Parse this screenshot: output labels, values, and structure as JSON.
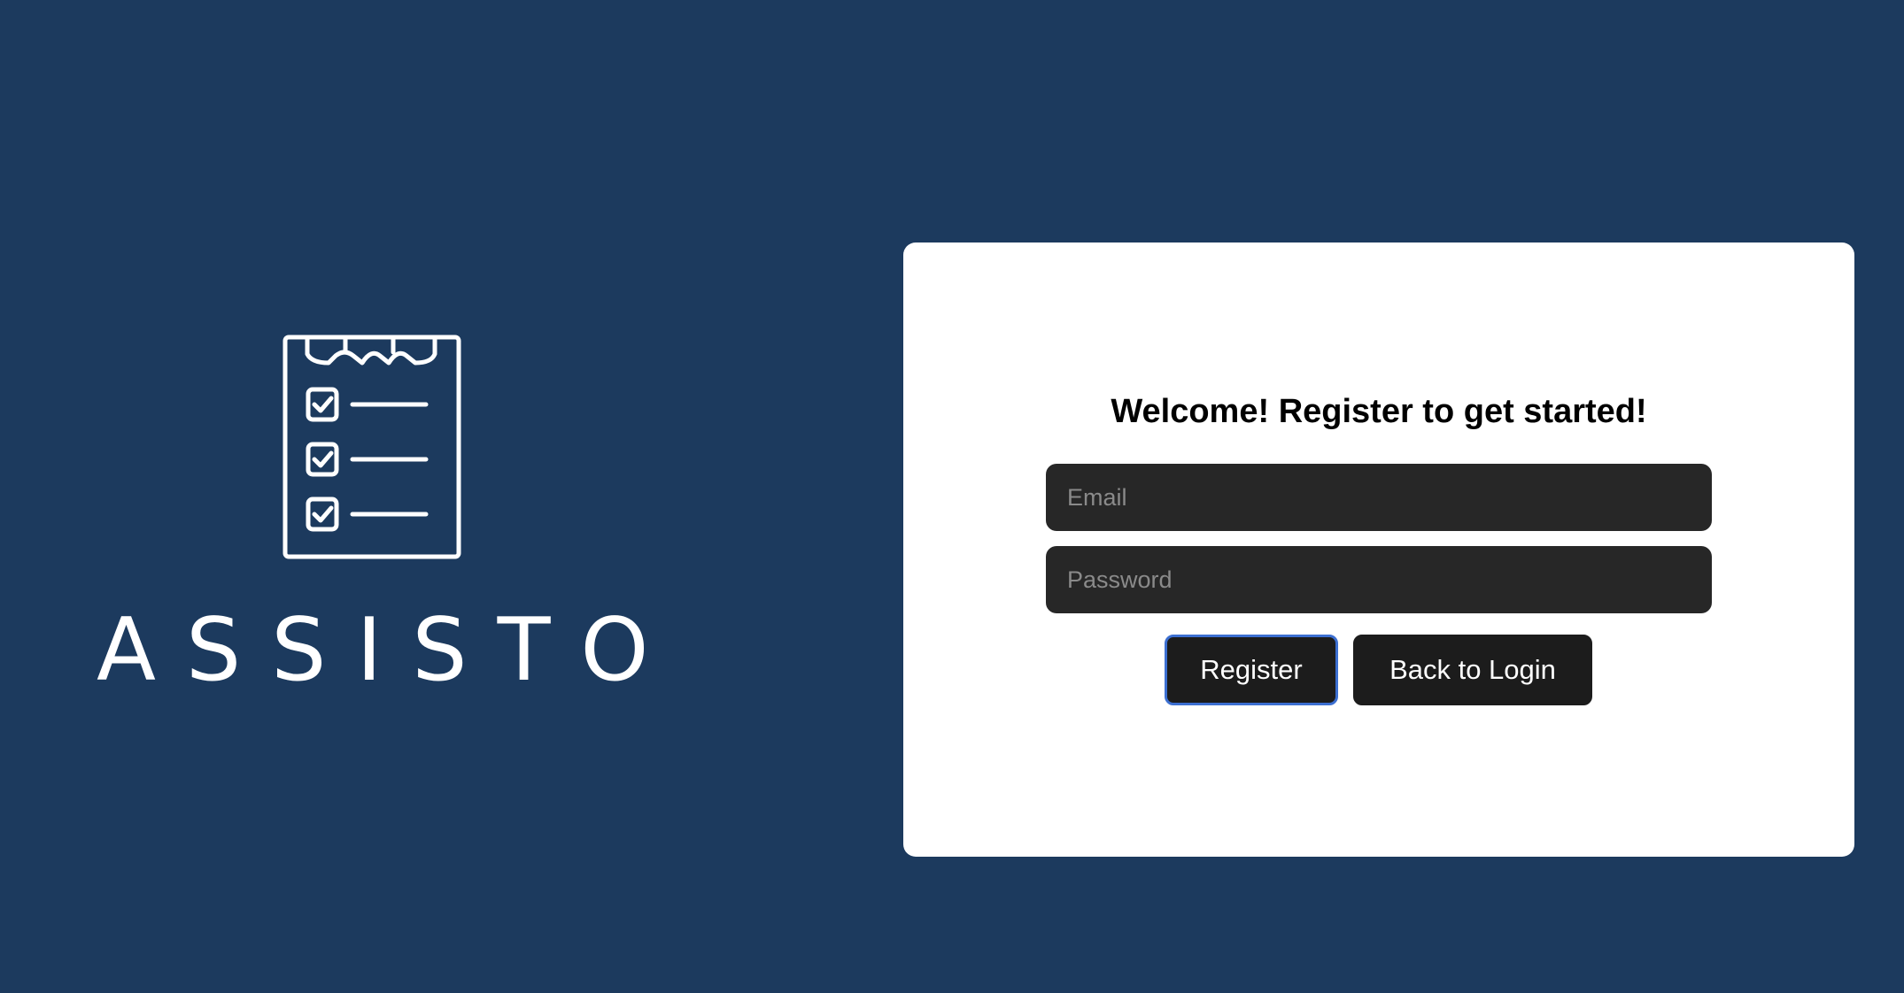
{
  "brand": {
    "logo_icon": "clipboard-checklist-icon",
    "name": "ASSISTO"
  },
  "register_form": {
    "title": "Welcome! Register to get started!",
    "email_placeholder": "Email",
    "email_value": "",
    "password_placeholder": "Password",
    "password_value": "",
    "register_label": "Register",
    "back_label": "Back to Login"
  },
  "colors": {
    "background": "#1c3a5e",
    "card": "#ffffff",
    "input": "#272727",
    "button": "#1c1c1c",
    "focus_ring": "#3c6fd1"
  }
}
